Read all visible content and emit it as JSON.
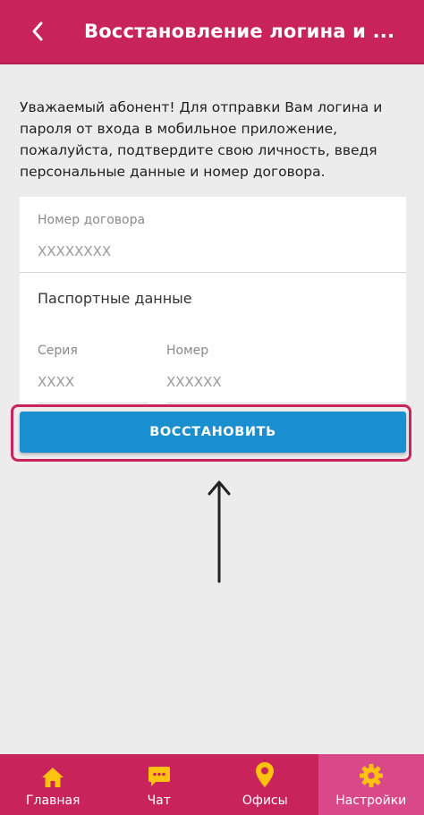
{
  "header": {
    "title": "Восстановление логина и ..."
  },
  "intro_text": "Уважаемый абонент! Для отправки Вам логина и пароля от входа в мобильное приложение, пожалуйста, подтвердите свою личность, введя персональные данные и номер договора.",
  "form": {
    "contract": {
      "label": "Номер договора",
      "placeholder": "XXXXXXXX"
    },
    "passport_title": "Паспортные данные",
    "series": {
      "label": "Серия",
      "placeholder": "XXXX"
    },
    "number": {
      "label": "Номер",
      "placeholder": "XXXXXX"
    }
  },
  "restore_button": "ВОССТАНОВИТЬ",
  "tabs": [
    {
      "label": "Главная",
      "icon": "home-icon"
    },
    {
      "label": "Чат",
      "icon": "chat-icon"
    },
    {
      "label": "Офисы",
      "icon": "location-pin-icon"
    },
    {
      "label": "Настройки",
      "icon": "gear-icon"
    }
  ],
  "colors": {
    "brand": "#c8235a",
    "active_tab": "#d9498a",
    "button": "#1a8fd0",
    "icon_yellow": "#ffc20e"
  }
}
